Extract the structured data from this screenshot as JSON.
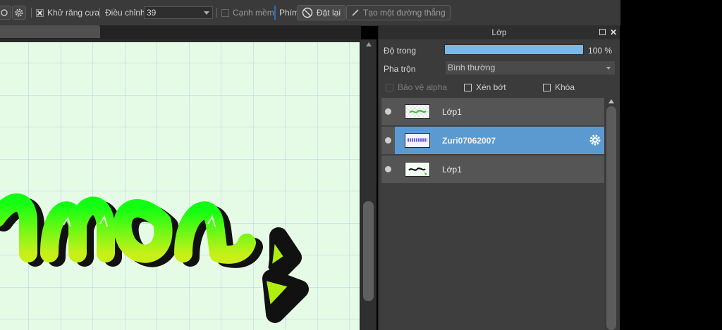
{
  "toolbar": {
    "antialias_label": "Khử răng cưa",
    "adjust_label": "Điều chỉnh",
    "adjust_value": "39",
    "edge_label": "Cạnh mềm",
    "key_label": "Phím",
    "reset_label": "Đặt lại",
    "line_label": "Tạo một đường thẳng"
  },
  "layers_panel": {
    "title": "Lớp",
    "opacity_label": "Độ trong",
    "opacity_value": "100 %",
    "opacity_fraction": 1.0,
    "blend_label": "Pha trộn",
    "blend_value": "Bình thường",
    "protect_alpha_label": "Bảo vệ alpha",
    "clipping_label": "Xén bớt",
    "lock_label": "Khóa",
    "layers": [
      {
        "name": "Lớp1",
        "selected": false
      },
      {
        "name": "Zuri07062007",
        "selected": true
      },
      {
        "name": "Lớp1",
        "selected": false
      }
    ]
  },
  "colors": {
    "selected_layer": "#5a9ad0",
    "opacity_bar": "#7ab8e6",
    "canvas_paper": "#e6fbe6",
    "lettering": "#22ee22"
  }
}
